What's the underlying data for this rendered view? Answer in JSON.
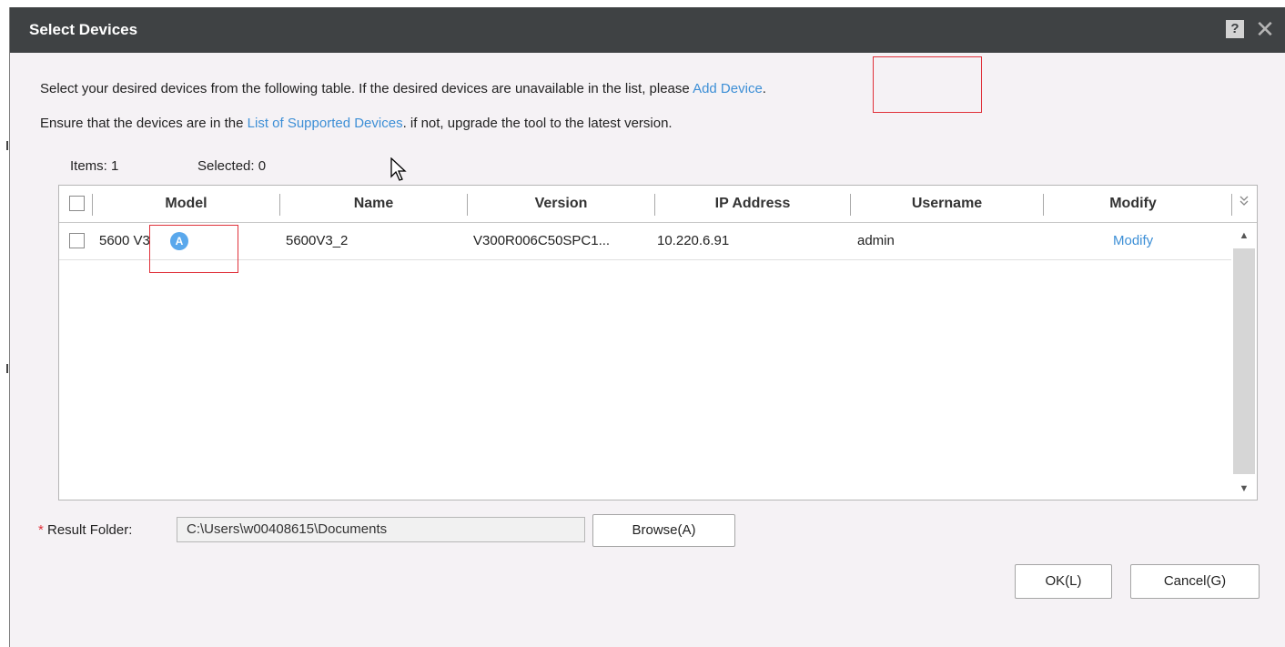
{
  "dialog": {
    "title": "Select Devices",
    "help_label": "?",
    "close_glyph": "✕"
  },
  "instructions": {
    "line1_text": "Select your desired devices from the following table. If the desired devices are unavailable in the list, please ",
    "line1_link": "Add Device",
    "line1_end": ".",
    "line2_text": "Ensure that the devices are in the ",
    "line2_link": "List of Supported Devices",
    "line2_end": ". if not, upgrade the tool to the latest version."
  },
  "counts": {
    "items": "Items: 1",
    "selected": "Selected: 0"
  },
  "table": {
    "headers": [
      "Model",
      "Name",
      "Version",
      "IP Address",
      "Username",
      "Modify"
    ],
    "column_chooser_icon": "double-chevron-down-icon",
    "rows": [
      {
        "model": "5600 V3",
        "status_icon": "online-status-icon",
        "status_glyph": "A",
        "name": "5600V3_2",
        "version": "V300R006C50SPC1...",
        "ip": "10.220.6.91",
        "username": "admin",
        "modify": "Modify"
      }
    ]
  },
  "result_folder": {
    "required_mark": "*",
    "label": " Result Folder:",
    "value": "C:\\Users\\w00408615\\Documents",
    "browse_label": "Browse(A)"
  },
  "footer": {
    "ok_label": "OK(L)",
    "cancel_label": "Cancel(G)"
  },
  "colors": {
    "titlebar": "#3f4244",
    "link": "#3d8fd6",
    "highlight_box": "#e0313a"
  }
}
